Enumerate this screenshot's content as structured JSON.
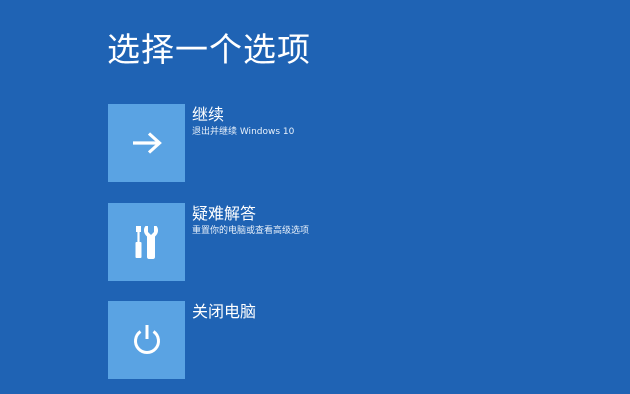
{
  "page": {
    "title": "选择一个选项",
    "background_color": "#1f63b4",
    "tile_color": "#5aa3e3"
  },
  "options": [
    {
      "id": "continue",
      "title": "继续",
      "description": "退出并继续 Windows 10",
      "icon": "arrow-right-icon"
    },
    {
      "id": "troubleshoot",
      "title": "疑难解答",
      "description": "重置你的电脑或查看高级选项",
      "icon": "tools-icon"
    },
    {
      "id": "shutdown",
      "title": "关闭电脑",
      "description": "",
      "icon": "power-icon"
    }
  ]
}
